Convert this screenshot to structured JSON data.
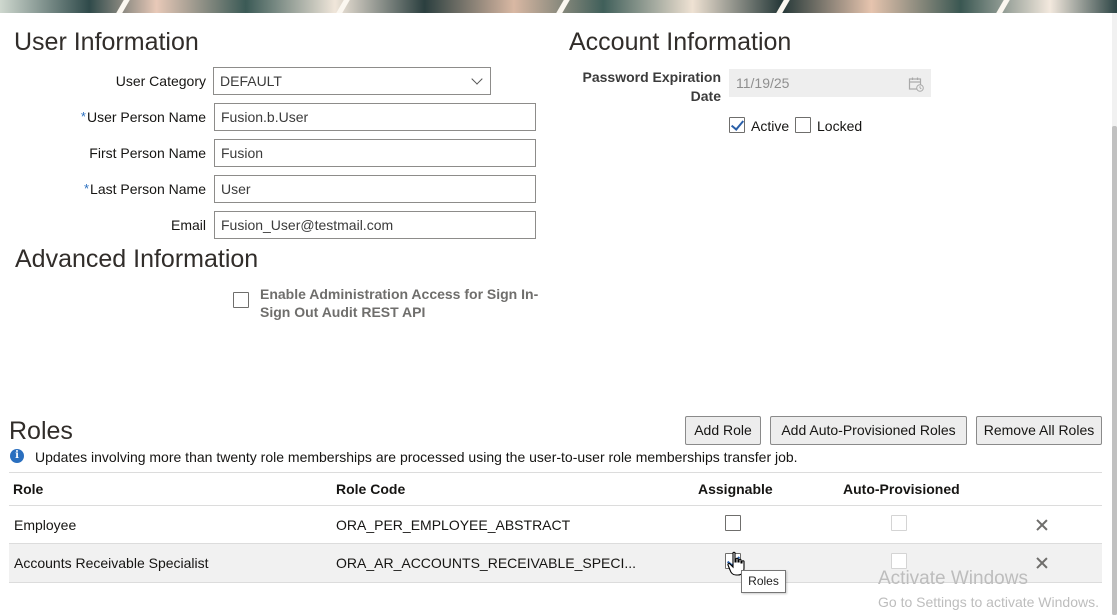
{
  "user_information": {
    "title": "User Information",
    "user_category_label": "User Category",
    "user_category_value": "DEFAULT",
    "user_person_name_label": "User Person Name",
    "user_person_name_value": "Fusion.b.User",
    "first_person_name_label": "First Person Name",
    "first_person_name_value": "Fusion",
    "last_person_name_label": "Last Person Name",
    "last_person_name_value": "User",
    "email_label": "Email",
    "email_value": "Fusion_User@testmail.com",
    "required_marker": "*"
  },
  "account_information": {
    "title": "Account Information",
    "password_expiration_label_line1": "Password Expiration",
    "password_expiration_label_line2": "Date",
    "password_expiration_value": "11/19/25",
    "active_label": "Active",
    "active_checked": true,
    "locked_label": "Locked",
    "locked_checked": false
  },
  "advanced_information": {
    "title": "Advanced Information",
    "enable_admin_access_label": "Enable Administration Access for Sign In-Sign Out Audit REST API",
    "enable_admin_access_checked": false
  },
  "roles": {
    "title": "Roles",
    "add_role_label": "Add Role",
    "add_auto_provisioned_label": "Add Auto-Provisioned Roles",
    "remove_all_label": "Remove All Roles",
    "info_text": "Updates involving more than twenty role memberships are processed using the user-to-user role memberships transfer job.",
    "columns": [
      "Role",
      "Role Code",
      "Assignable",
      "Auto-Provisioned"
    ],
    "rows": [
      {
        "role": "Employee",
        "role_code": "ORA_PER_EMPLOYEE_ABSTRACT",
        "assignable": false,
        "auto_provisioned": false
      },
      {
        "role": "Accounts Receivable Specialist",
        "role_code": "ORA_AR_ACCOUNTS_RECEIVABLE_SPECI...",
        "assignable": true,
        "auto_provisioned": false
      }
    ],
    "tooltip": "Roles"
  },
  "watermark": {
    "line1": "Activate Windows",
    "line2": "Go to Settings to activate Windows."
  },
  "icons": {
    "info": "info-icon",
    "calendar": "calendar-icon",
    "remove": "close-icon",
    "dropdown": "chevron-down-icon"
  },
  "colors": {
    "required_marker": "#2a6fbf",
    "checkbox_check": "#2a5fa8",
    "info_icon": "#2a6fbf"
  }
}
